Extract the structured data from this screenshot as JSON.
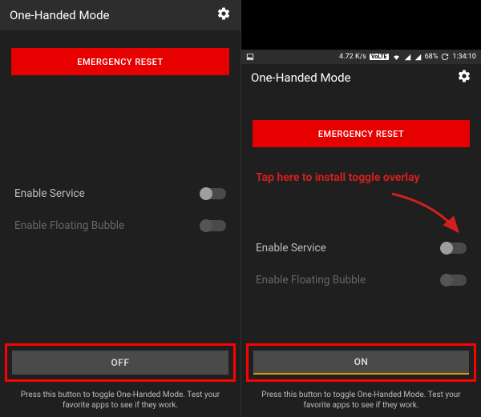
{
  "left": {
    "header_title": "One-Handed Mode",
    "reset_label": "EMERGENCY RESET",
    "enable_service_label": "Enable Service",
    "enable_bubble_label": "Enable Floating Bubble",
    "big_button_label": "OFF",
    "hint_text": "Press this button to toggle One-Handed Mode. Test your favorite apps to see if they work."
  },
  "right": {
    "status": {
      "speed": "4.72 K/s",
      "volte": "VoLTE",
      "battery_pct": "68%",
      "time": "1:34:10"
    },
    "header_title": "One-Handed Mode",
    "reset_label": "EMERGENCY RESET",
    "annotation": "Tap here to install toggle overlay",
    "enable_service_label": "Enable Service",
    "enable_bubble_label": "Enable Floating Bubble",
    "big_button_label": "ON",
    "hint_text": "Press this button to toggle One-Handed Mode. Test your favorite apps to see if they work."
  }
}
